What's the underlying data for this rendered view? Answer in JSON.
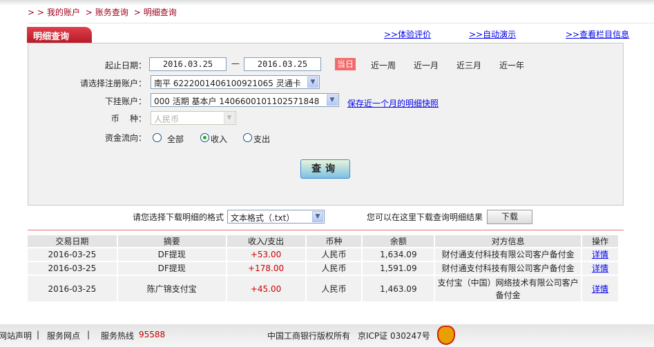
{
  "breadcrumb": {
    "items": [
      "我的账户",
      "账务查询",
      "明细查询"
    ]
  },
  "tab": {
    "title": "明细查询"
  },
  "top_links": [
    "体验评价",
    "自动演示",
    "查看栏目信息"
  ],
  "form": {
    "date_label": "起止日期：",
    "date_from": "2016.03.25",
    "date_sep": "—",
    "date_to": "2016.03.25",
    "quick_ranges": [
      "当日",
      "近一周",
      "近一月",
      "近三月",
      "近一年"
    ],
    "account_label": "请选择注册账户：",
    "account_value": "南平  6222001406100921065 灵通卡",
    "sub_account_label": "下挂账户：",
    "sub_account_value": "000 活期 基本户 1406600101102571848",
    "snapshot_link": "保存近一个月的明细快照",
    "currency_label": "币    种：",
    "currency_value": "人民币",
    "flow_label": "资金流向：",
    "flow_options": [
      "全部",
      "收入",
      "支出"
    ],
    "flow_selected": "收入",
    "query_button": "查询"
  },
  "download": {
    "format_label": "请您选择下载明细的格式",
    "format_value": "文本格式（.txt）",
    "hint": "您可以在这里下载查询明细结果",
    "button": "下载"
  },
  "table": {
    "headers": [
      "交易日期",
      "摘要",
      "收入/支出",
      "币种",
      "余额",
      "对方信息",
      "操作"
    ],
    "rows": [
      [
        "2016-03-25",
        "DF提现",
        "+53.00",
        "人民币",
        "1,634.09",
        "财付通支付科技有限公司客户备付金",
        "详情"
      ],
      [
        "2016-03-25",
        "DF提现",
        "+178.00",
        "人民币",
        "1,591.09",
        "财付通支付科技有限公司客户备付金",
        "详情"
      ],
      [
        "2016-03-25",
        "陈广锦支付宝",
        "+45.00",
        "人民币",
        "1,463.09",
        "支付宝（中国）网络技术有限公司客户备付金",
        "详情"
      ]
    ]
  },
  "footer": {
    "statement": "网站声明",
    "outlets": "服务网点",
    "hotline_label": "服务热线",
    "hotline": "95588",
    "copyright": "中国工商银行版权所有",
    "icp": "京ICP证 030247号"
  }
}
